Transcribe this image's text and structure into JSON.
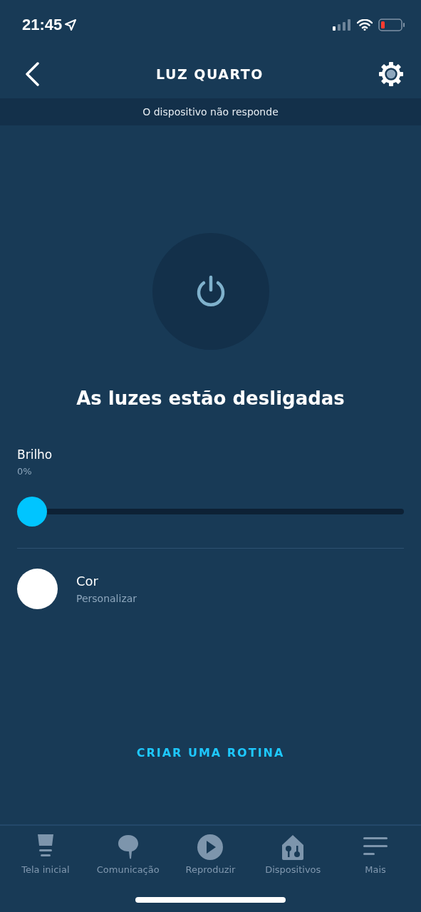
{
  "status_bar": {
    "time": "21:45"
  },
  "header": {
    "title": "LUZ QUARTO"
  },
  "banner": {
    "text": "O dispositivo não responde"
  },
  "power": {
    "on": false,
    "status": "As luzes estão desligadas"
  },
  "brightness": {
    "label": "Brilho",
    "reading": "0%",
    "level": 0
  },
  "color_setting": {
    "label": "Cor",
    "value": "Personalizar",
    "color": "#ffffff"
  },
  "routine_link": "CRIAR UMA ROTINA",
  "nav": [
    {
      "kind": "home",
      "label": "Tela inicial",
      "selected": false
    },
    {
      "kind": "chat",
      "label": "Comunicação",
      "selected": false
    },
    {
      "kind": "play",
      "label": "Reproduzir",
      "selected": false
    },
    {
      "kind": "devices",
      "label": "Dispositivos",
      "selected": false
    },
    {
      "kind": "more",
      "label": "Mais",
      "selected": false
    }
  ]
}
